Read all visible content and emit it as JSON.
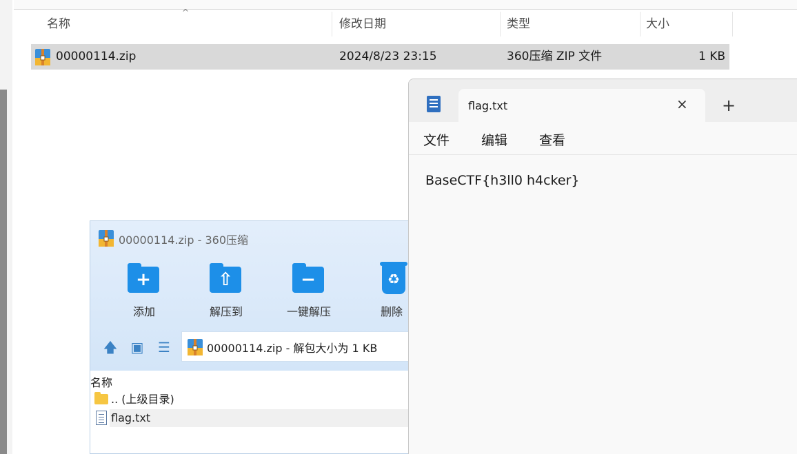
{
  "explorer": {
    "columns": {
      "name": "名称",
      "modified": "修改日期",
      "type": "类型",
      "size": "大小"
    },
    "sort_indicator": "^",
    "files": [
      {
        "name": "00000114.zip",
        "modified": "2024/8/23 23:15",
        "type": "360压缩 ZIP 文件",
        "size": "1 KB",
        "icon": "zip-archive-icon"
      }
    ]
  },
  "zip_window": {
    "title": "00000114.zip - 360压缩",
    "toolbar": [
      {
        "label": "添加",
        "icon": "add-folder-icon"
      },
      {
        "label": "解压到",
        "icon": "extract-to-icon"
      },
      {
        "label": "一键解压",
        "icon": "one-click-extract-icon"
      },
      {
        "label": "删除",
        "icon": "recycle-bin-icon"
      }
    ],
    "address": "00000114.zip - 解包大小为 1 KB",
    "list_header": "名称",
    "items": [
      {
        "name": ".. (上级目录)",
        "icon": "folder-icon"
      },
      {
        "name": "flag.txt",
        "icon": "text-file-icon"
      }
    ]
  },
  "notepad": {
    "tab_title": "flag.txt",
    "menu": [
      "文件",
      "编辑",
      "查看"
    ],
    "content": "BaseCTF{h3ll0 h4cker}",
    "close_glyph": "×",
    "new_tab_glyph": "+"
  },
  "colors": {
    "accent_blue": "#1d8fe8",
    "selection_gray": "#d9d9d9",
    "notepad_bg": "#f9f9f9"
  }
}
